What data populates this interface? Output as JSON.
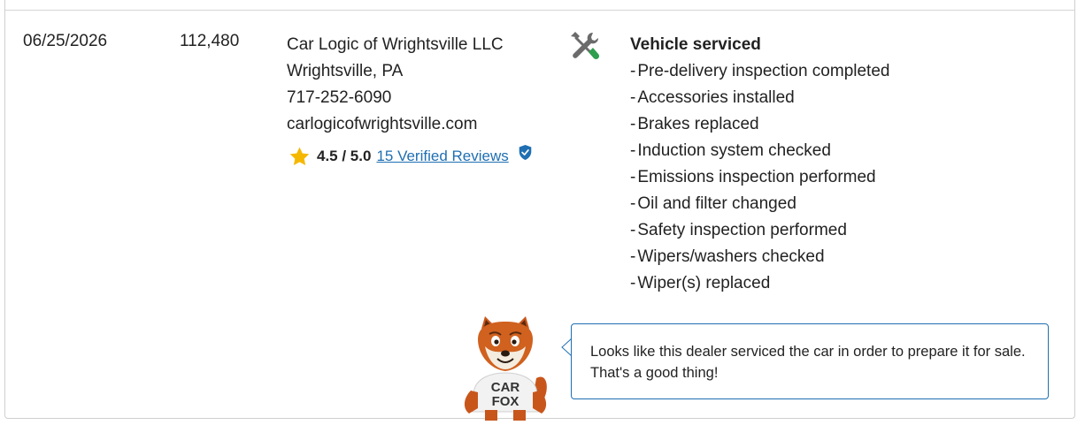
{
  "record": {
    "date": "06/25/2026",
    "odometer": "112,480",
    "dealer": {
      "name": "Car Logic of Wrightsville LLC",
      "location": "Wrightsville, PA",
      "phone": "717-252-6090",
      "website": "carlogicofwrightsville.com"
    },
    "rating": {
      "score": "4.5 / 5.0",
      "reviews_link": "15 Verified Reviews"
    },
    "service": {
      "icon": "wrench-screwdriver-icon",
      "title": "Vehicle serviced",
      "items": [
        "Pre-delivery inspection completed",
        "Accessories installed",
        "Brakes replaced",
        "Induction system checked",
        "Emissions inspection performed",
        "Oil and filter changed",
        "Safety inspection performed",
        "Wipers/washers checked",
        "Wiper(s) replaced"
      ]
    }
  },
  "carfox": {
    "shirt_text_line1": "CAR",
    "shirt_text_line2": "FOX",
    "tip": "Looks like this dealer serviced the car in order to prepare it for sale. That's a good thing!"
  },
  "colors": {
    "link": "#1f6fb2",
    "star": "#f5b800",
    "wrench_green": "#2e9e4f",
    "bubble_border": "#1f6fb2"
  }
}
